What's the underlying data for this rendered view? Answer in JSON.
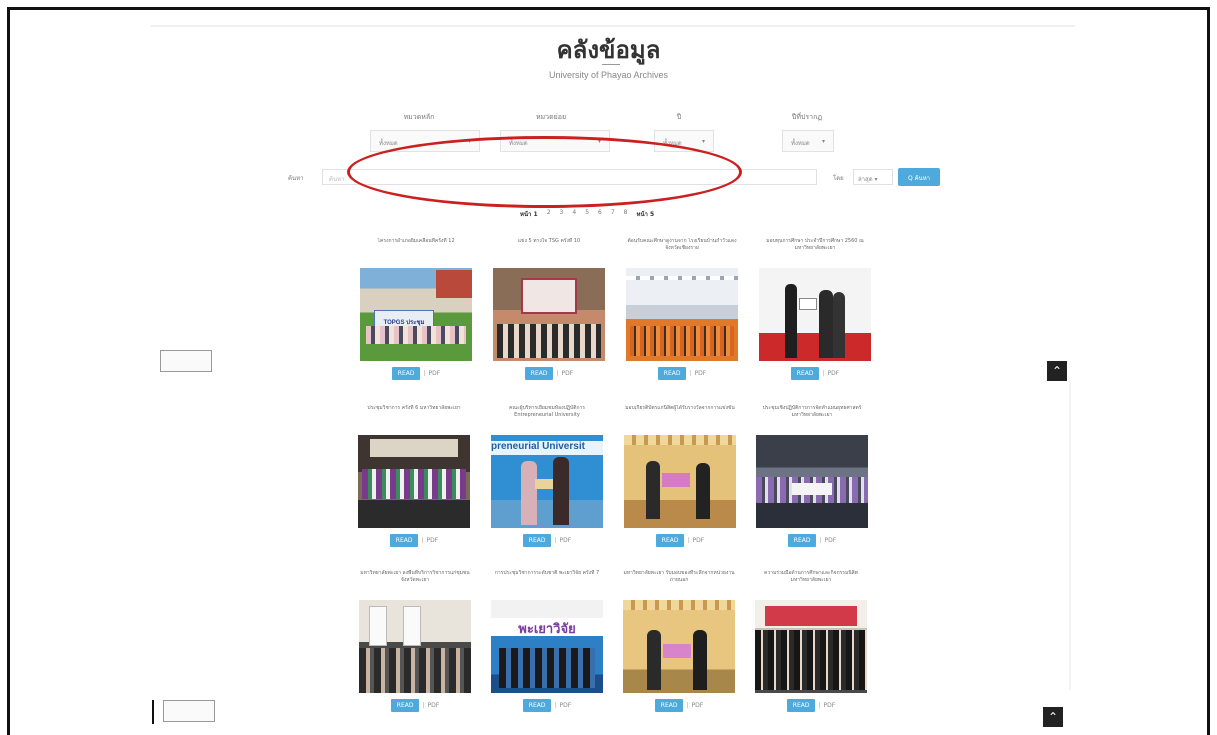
{
  "header": {
    "title": "คลังข้อมูล",
    "subtitle": "University of Phayao Archives"
  },
  "filters": [
    {
      "label": "หมวดหลัก",
      "value": "ทั้งหมด"
    },
    {
      "label": "หมวดย่อย",
      "value": "ทั้งหมด"
    },
    {
      "label": "ปี",
      "value": "ทั้งหมด"
    },
    {
      "label": "ปีที่ปรากฏ",
      "value": "ทั้งหมด"
    }
  ],
  "search": {
    "label": "ค้นหา",
    "placeholder": "ค้นหา",
    "sort_label": "โดย",
    "sort_value": "ล่าสุด",
    "button_label": "Q ค้นหา"
  },
  "pagination": {
    "first": "หน้า 1",
    "pages": [
      "2",
      "3",
      "4",
      "5",
      "6",
      "7",
      "8"
    ],
    "last": "หน้า 5"
  },
  "cards": [
    {
      "title": "โครงการอำเภอยิ้มเคลื่อนที่ครั้งที่ 12"
    },
    {
      "title": "แข่ง 5 ทางใจ TSG ครั้งที่ 10"
    },
    {
      "title": "ต้อนรับคณะศึกษาดูงานจาก โรงเรียนบ้านถ้ำวัวแดง จังหวัดเชียงราย"
    },
    {
      "title": "มอบทุนการศึกษา ประจำปีการศึกษา 2560 ณ มหาวิทยาลัยพะเยา"
    },
    {
      "title": "ประชุมวิชาการ ครั้งที่ 6 มหาวิทยาลัยพะเยา"
    },
    {
      "title": "คณะผู้บริหารเยี่ยมชมห้องปฏิบัติการ Entrepreneurial University"
    },
    {
      "title": "มอบเกียรติบัตรแก่นิสิตผู้ได้รับรางวัลจากการแข่งขัน"
    },
    {
      "title": "ประชุมเชิงปฏิบัติการการจัดทำแผนยุทธศาสตร์ มหาวิทยาลัยพะเยา"
    },
    {
      "title": "มหาวิทยาลัยพะเยา ลงพื้นที่บริการวิชาการแก่ชุมชน จังหวัดพะเยา"
    },
    {
      "title": "การประชุมวิชาการระดับชาติ พะเยาวิจัย ครั้งที่ 7"
    },
    {
      "title": "มหาวิทยาลัยพะเยา รับมอบของที่ระลึกจากหน่วยงานภายนอก"
    },
    {
      "title": "ความร่วมมือด้านการศึกษาและกิจกรรมนิสิต มหาวิทยาลัยพะเยา"
    }
  ],
  "card_actions": {
    "read_label": "READ",
    "separator": "|",
    "pdf_label": "PDF"
  },
  "banners": {
    "phayao_research": "พะเยาวิจัย",
    "entrepreneurial": "preneurial Universit"
  },
  "photo_banner_1": "TOPGS ประชุม",
  "colors": {
    "accent": "#4ea9dc",
    "highlight": "#cc2020"
  }
}
